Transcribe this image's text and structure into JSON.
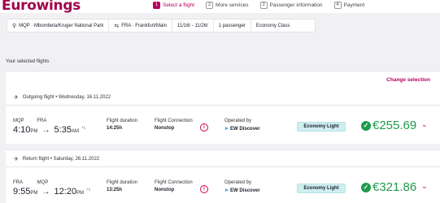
{
  "header": {
    "logo": "Eurowings",
    "steps": [
      {
        "num": "1",
        "label": "Select a flight",
        "active": true
      },
      {
        "num": "2",
        "label": "More services",
        "active": false
      },
      {
        "num": "3",
        "label": "Passenger information",
        "active": false
      },
      {
        "num": "4",
        "label": "Payment",
        "active": false
      }
    ]
  },
  "search": {
    "origin": "MQP · Mbombela/Kruger National Park",
    "destination": "FRA · Frankfurt/Main",
    "dates": "11/16/ - 11/26/",
    "passengers": "1 passenger",
    "cabin": "Economy Class"
  },
  "selected_label": "Your selected flights",
  "change_selection": "Change selection",
  "flights": [
    {
      "heading": "Outgoing flight • Wednesday, 16.11.2022",
      "from_code": "MQP",
      "to_code": "FRA",
      "dep_time_hour": "4:10",
      "dep_suffix": "PM",
      "arr_time": "5:35",
      "arr_suffix": "AM",
      "arr_plus": "+1",
      "duration_label": "Flight duration",
      "duration": "14:25h",
      "connection_label": "Flight Connection",
      "connection": "Nonstop",
      "operated_label": "Operated by",
      "operator": "EW Discover",
      "fare": "Economy Light",
      "price": "€255.69"
    },
    {
      "heading": "Return flight • Saturday, 26.11.2022",
      "from_code": "FRA",
      "to_code": "MQP",
      "dep_time_hour": "9:55",
      "dep_suffix": "PM",
      "arr_time": "12:20",
      "arr_suffix": "PM",
      "arr_plus": "+1",
      "duration_label": "Flight duration",
      "duration": "13:25h",
      "connection_label": "Flight Connection",
      "connection": "Nonstop",
      "operated_label": "Operated by",
      "operator": "EW Discover",
      "fare": "Economy Light",
      "price": "€321.86"
    }
  ],
  "colors": {
    "brand": "#a3004d",
    "accent": "#b3005e",
    "price_green": "#1e9b4b",
    "badge_bg": "#cfeef0"
  }
}
